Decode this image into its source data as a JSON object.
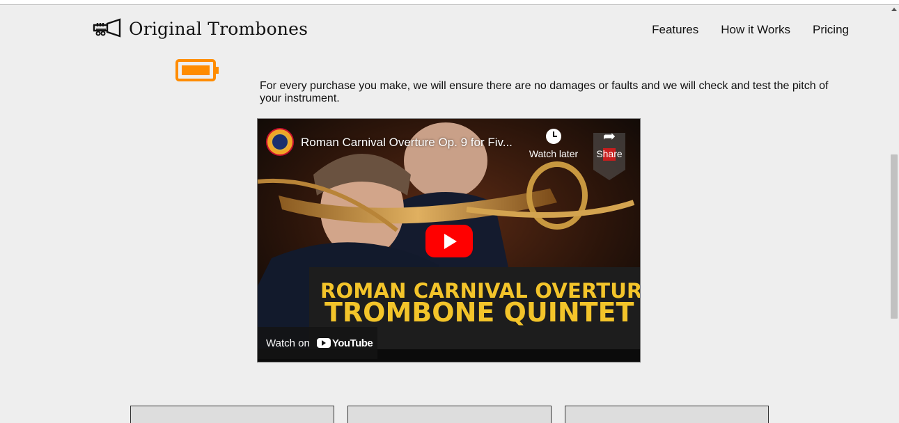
{
  "header": {
    "logo_text": "Original Trombones",
    "logo_icon": "trumpet-icon",
    "nav": [
      "Features",
      "How it Works",
      "Pricing"
    ]
  },
  "feature": {
    "icon": "battery-full-icon",
    "icon_color": "#ff8c00",
    "description": "For every purchase you make, we will ensure there are no damages or faults and we will check and test the pitch of your instrument."
  },
  "video": {
    "title": "Roman Carnival Overture Op. 9 for Fiv...",
    "watch_later": "Watch later",
    "share": "Share",
    "banner_line1": "ROMAN CARNIVAL OVERTURE",
    "banner_line2": "TROMBONE QUINTET",
    "watch_on": "Watch on",
    "youtube": "YouTube",
    "accent_color": "#f3c42a",
    "play_color": "#ff0000"
  },
  "cards": [
    {},
    {},
    {}
  ]
}
